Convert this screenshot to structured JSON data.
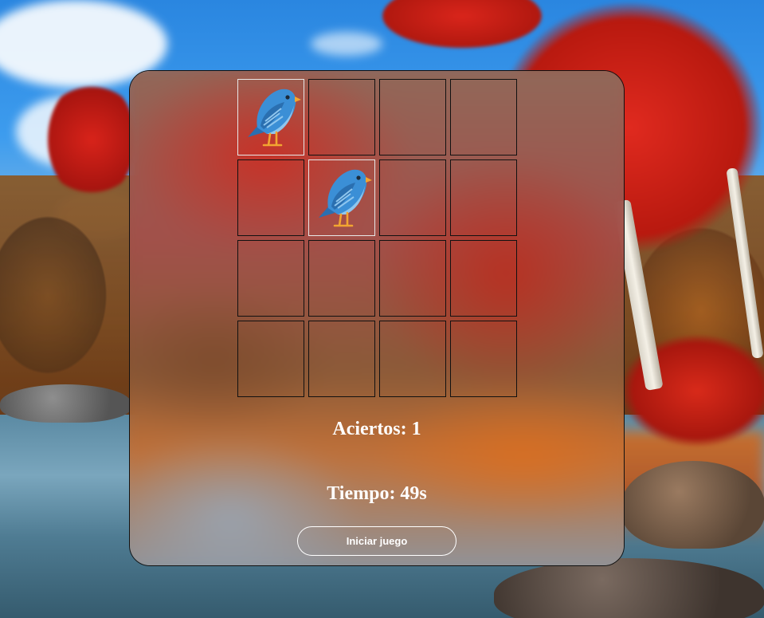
{
  "game": {
    "hits_text": "Aciertos: 1",
    "time_text": "Tiempo: 49s",
    "start_button_label": "Iniciar juego"
  },
  "board": {
    "cards": [
      {
        "icon": "bird-icon",
        "revealed": true
      },
      {
        "icon": null,
        "revealed": false
      },
      {
        "icon": null,
        "revealed": false
      },
      {
        "icon": null,
        "revealed": false
      },
      {
        "icon": null,
        "revealed": false
      },
      {
        "icon": "bird-icon",
        "revealed": true
      },
      {
        "icon": null,
        "revealed": false
      },
      {
        "icon": null,
        "revealed": false
      },
      {
        "icon": null,
        "revealed": false
      },
      {
        "icon": null,
        "revealed": false
      },
      {
        "icon": null,
        "revealed": false
      },
      {
        "icon": null,
        "revealed": false
      },
      {
        "icon": null,
        "revealed": false
      },
      {
        "icon": null,
        "revealed": false
      },
      {
        "icon": null,
        "revealed": false
      },
      {
        "icon": null,
        "revealed": false
      }
    ]
  },
  "colors": {
    "bird_body": "#3b8fd6",
    "bird_wing": "#2a6fb0",
    "bird_belly": "#8fc6ee",
    "bird_beak": "#f2a531",
    "bird_feet": "#f2a531",
    "revealed_border": "#e8e8e8",
    "hidden_border": "#111111"
  }
}
